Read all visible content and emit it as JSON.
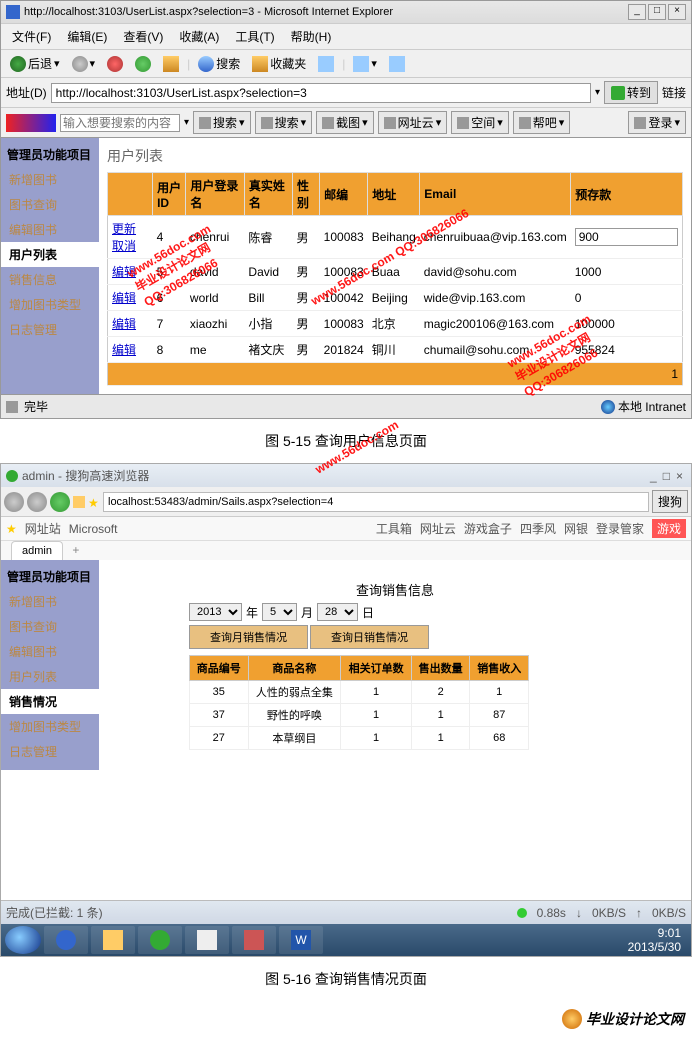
{
  "ie": {
    "title": "http://localhost:3103/UserList.aspx?selection=3 - Microsoft Internet Explorer",
    "menus": [
      "文件(F)",
      "编辑(E)",
      "查看(V)",
      "收藏(A)",
      "工具(T)",
      "帮助(H)"
    ],
    "back": "后退",
    "search": "搜索",
    "fav": "收藏夹",
    "addr_label": "地址(D)",
    "url": "http://localhost:3103/UserList.aspx?selection=3",
    "go": "转到",
    "links": "链接",
    "baidu_placeholder": "输入想要搜索的内容",
    "baidu_search": "搜索",
    "baidu_block": "搜索",
    "baidu_cap": "截图",
    "baidu_net": "网址云",
    "baidu_space": "空间",
    "baidu_help": "帮吧",
    "baidu_login": "登录",
    "status": "完毕",
    "zone": "本地 Intranet"
  },
  "sidebar": {
    "header": "管理员功能项目",
    "items": [
      "新增图书",
      "图书查询",
      "编辑图书",
      "用户列表",
      "销售信息",
      "增加图书类型",
      "日志管理"
    ],
    "active_idx": 3
  },
  "page": {
    "title": "用户列表",
    "cols": [
      "",
      "用户ID",
      "用户登录名",
      "真实姓名",
      "性别",
      "邮编",
      "地址",
      "Email",
      "预存款"
    ],
    "rows": [
      {
        "action_a": "更新",
        "action_b": "取消",
        "id": "4",
        "login": "chenrui",
        "name": "陈睿",
        "sex": "男",
        "zip": "100083",
        "addr": "Beihang",
        "email": "chenruibuaa@vip.163.com",
        "deposit": "900",
        "editing": true
      },
      {
        "action_a": "编辑",
        "id": "5",
        "login": "david",
        "name": "David",
        "sex": "男",
        "zip": "100083",
        "addr": "Buaa",
        "email": "david@sohu.com",
        "deposit": "1000"
      },
      {
        "action_a": "编辑",
        "id": "6",
        "login": "world",
        "name": "Bill",
        "sex": "男",
        "zip": "100042",
        "addr": "Beijing",
        "email": "wide@vip.163.com",
        "deposit": "0"
      },
      {
        "action_a": "编辑",
        "id": "7",
        "login": "xiaozhi",
        "name": "小指",
        "sex": "男",
        "zip": "100083",
        "addr": "北京",
        "email": "magic200106@163.com",
        "deposit": "100000"
      },
      {
        "action_a": "编辑",
        "id": "8",
        "login": "me",
        "name": "褚文庆",
        "sex": "男",
        "zip": "201824",
        "addr": "铜川",
        "email": "chumail@sohu.com",
        "deposit": "955824"
      }
    ],
    "pager": "1"
  },
  "caption1": "图 5-15   查询用户信息页面",
  "w7": {
    "title": "admin - 搜狗高速浏览器",
    "url": "localhost:53483/admin/Sails.aspx?selection=4",
    "tab": "admin",
    "bookmarks": [
      "网址站",
      "Microsoft"
    ],
    "right_bm": [
      "工具箱",
      "网址云",
      "游戏盒子",
      "四季风",
      "网银",
      "登录管家",
      "游戏"
    ],
    "search_btn": "搜狗"
  },
  "sidebar2": {
    "header": "管理员功能项目",
    "items": [
      "新增图书",
      "图书查询",
      "编辑图书",
      "用户列表",
      "销售情况",
      "增加图书类型",
      "日志管理"
    ],
    "active_idx": 4
  },
  "sales": {
    "title": "查询销售信息",
    "year": "2013",
    "year_u": "年",
    "month": "5",
    "month_u": "月",
    "day": "28",
    "day_u": "日",
    "btn_month": "查询月销售情况",
    "btn_day": "查询日销售情况",
    "cols": [
      "商品编号",
      "商品名称",
      "相关订单数",
      "售出数量",
      "销售收入"
    ],
    "rows": [
      {
        "id": "35",
        "name": "人性的弱点全集",
        "orders": "1",
        "qty": "2",
        "rev": "1"
      },
      {
        "id": "37",
        "name": "野性的呼唤",
        "orders": "1",
        "qty": "1",
        "rev": "87"
      },
      {
        "id": "27",
        "name": "本草纲目",
        "orders": "1",
        "qty": "1",
        "rev": "68"
      }
    ]
  },
  "w7status": {
    "done": "完成(已拦截: 1 条)",
    "speed": "0.88s",
    "dl": "0KB/S",
    "ul": "0KB/S"
  },
  "tray": {
    "time": "9:01",
    "date": "2013/5/30"
  },
  "caption2": "图 5-16   查询销售情况页面",
  "footer_logo": "毕业设计论文网",
  "watermarks": {
    "url": "www.56doc.com",
    "text": "毕业设计论文网",
    "qq": "QQ:306826066"
  }
}
